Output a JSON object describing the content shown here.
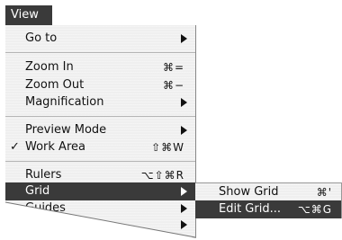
{
  "menu_title": "View",
  "items": [
    {
      "label": "Go to",
      "shortcut": "",
      "submenu": true,
      "checked": false
    },
    {
      "label": "Zoom In",
      "shortcut": "⌘=",
      "submenu": false,
      "checked": false
    },
    {
      "label": "Zoom Out",
      "shortcut": "⌘−",
      "submenu": false,
      "checked": false
    },
    {
      "label": "Magnification",
      "shortcut": "",
      "submenu": true,
      "checked": false
    },
    {
      "label": "Preview Mode",
      "shortcut": "",
      "submenu": true,
      "checked": false
    },
    {
      "label": "Work Area",
      "shortcut": "⇧⌘W",
      "submenu": false,
      "checked": true,
      "check_mark": "✓"
    },
    {
      "label": "Rulers",
      "shortcut": "⌥⇧⌘R",
      "submenu": false,
      "checked": false
    },
    {
      "label": "Grid",
      "shortcut": "",
      "submenu": true,
      "checked": false,
      "highlighted": true
    },
    {
      "label": "Guides",
      "shortcut": "",
      "submenu": true,
      "checked": false
    },
    {
      "label": "",
      "shortcut": "",
      "submenu": true,
      "checked": false
    }
  ],
  "grid_submenu": [
    {
      "label": "Show Grid",
      "shortcut": "⌘'"
    },
    {
      "label": "Edit Grid...",
      "shortcut": "⌥⌘G",
      "highlighted": true
    }
  ],
  "colors": {
    "highlight": "#3a3a3a",
    "menu_bg": "#efefef",
    "separator": "#b5b5b5"
  }
}
